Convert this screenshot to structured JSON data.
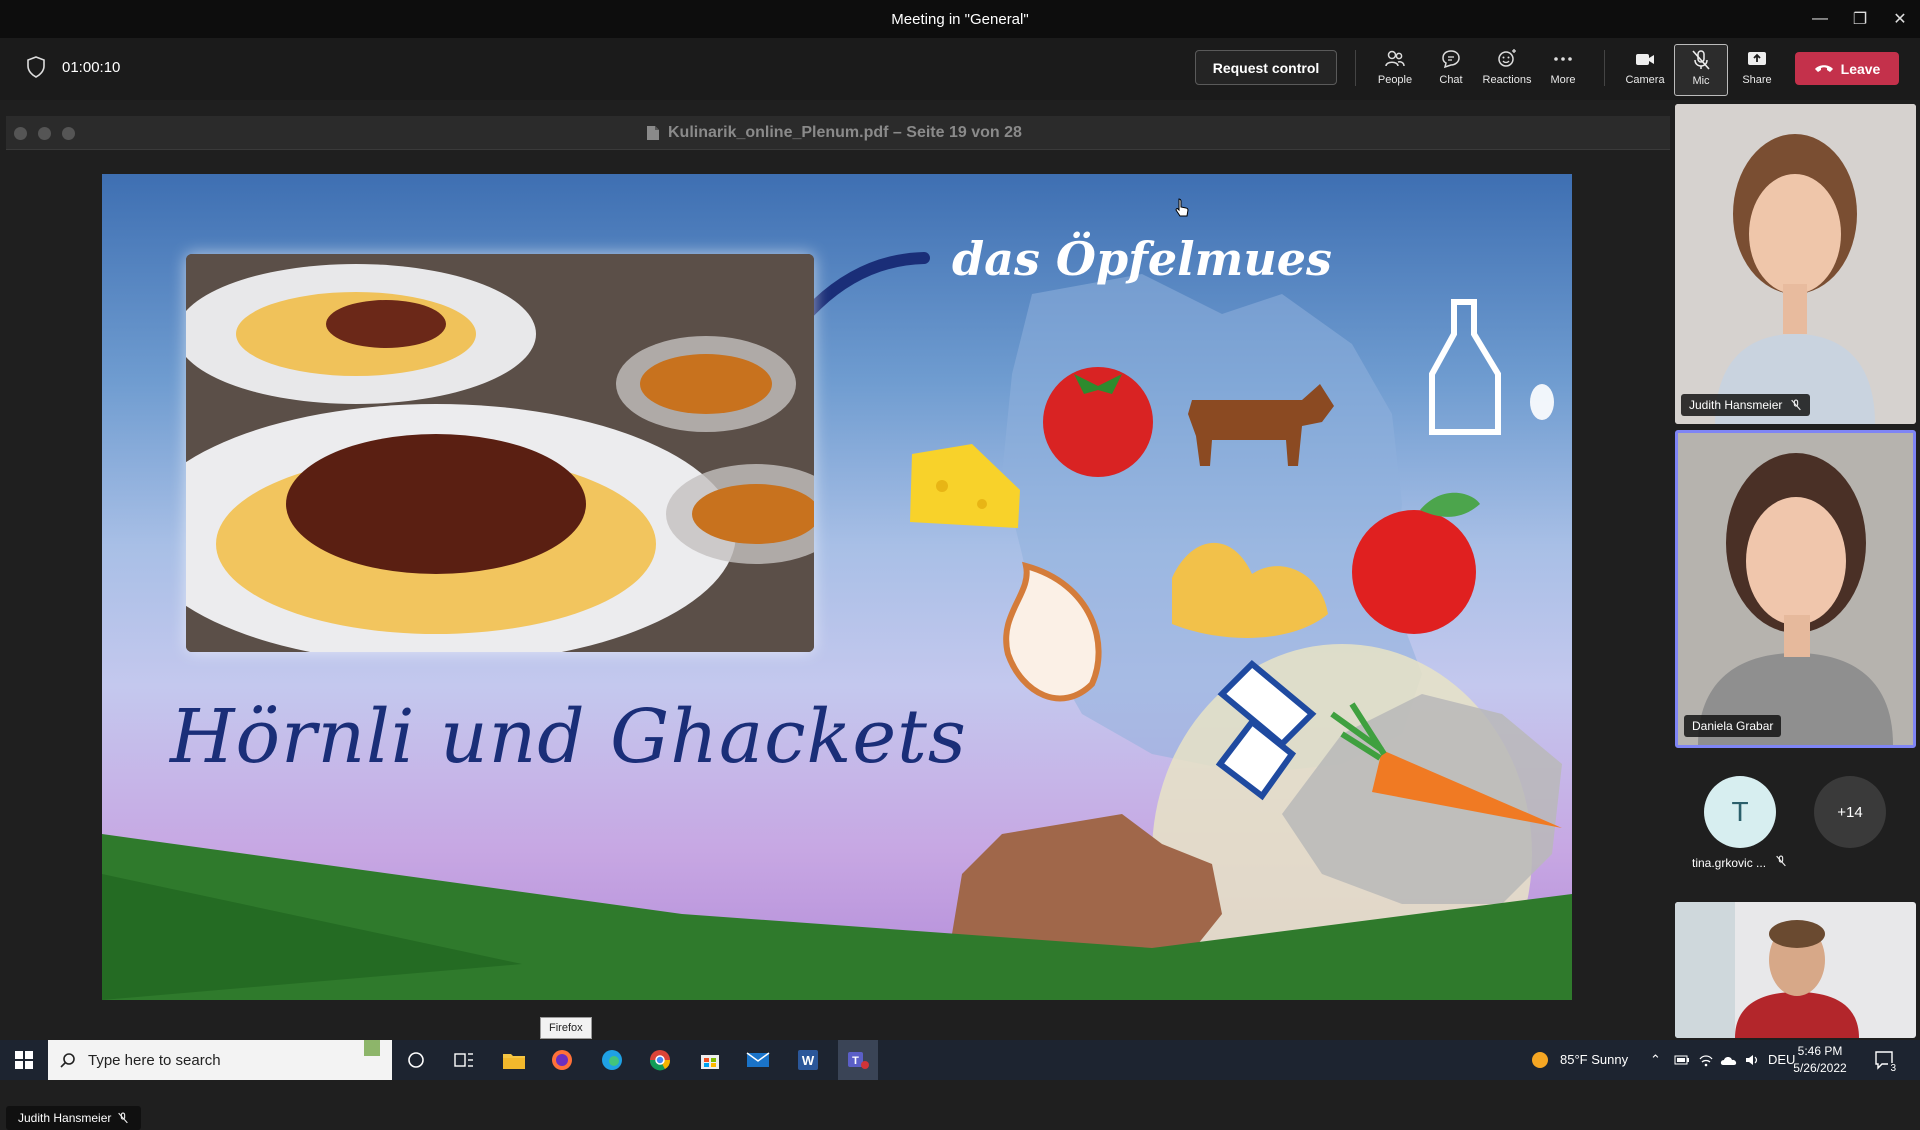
{
  "window": {
    "title": "Meeting in \"General\""
  },
  "toolbar": {
    "timer": "01:00:10",
    "request_control": "Request control",
    "tools": [
      {
        "label": "People",
        "icon": "people-icon"
      },
      {
        "label": "Chat",
        "icon": "chat-icon"
      },
      {
        "label": "Reactions",
        "icon": "reactions-icon"
      },
      {
        "label": "More",
        "icon": "more-icon"
      },
      {
        "label": "Camera",
        "icon": "camera-icon"
      },
      {
        "label": "Mic",
        "icon": "mic-off-icon"
      },
      {
        "label": "Share",
        "icon": "share-icon"
      }
    ],
    "leave": "Leave",
    "leave_color": "#c4314b"
  },
  "share": {
    "pdf_title": "Kulinarik_online_Plenum.pdf – Seite 19 von 28",
    "presenter": "Judith Hansmeier"
  },
  "slide": {
    "title": "Hörnli und Ghackets",
    "subtitle": "das Öpfelmues"
  },
  "participants": {
    "tiles": [
      {
        "name": "Judith Hansmeier",
        "muted": true
      },
      {
        "name": "Daniela Grabar",
        "muted": false,
        "speaking": true
      }
    ],
    "avatar_initial": "T",
    "avatar_name": "tina.grkovic ...",
    "overflow": "+14"
  },
  "taskbar": {
    "search_placeholder": "Type here to search",
    "tooltip": "Firefox",
    "weather": "85°F  Sunny",
    "language": "DEU",
    "time": "5:46 PM",
    "date": "5/26/2022",
    "notifications": "3"
  }
}
